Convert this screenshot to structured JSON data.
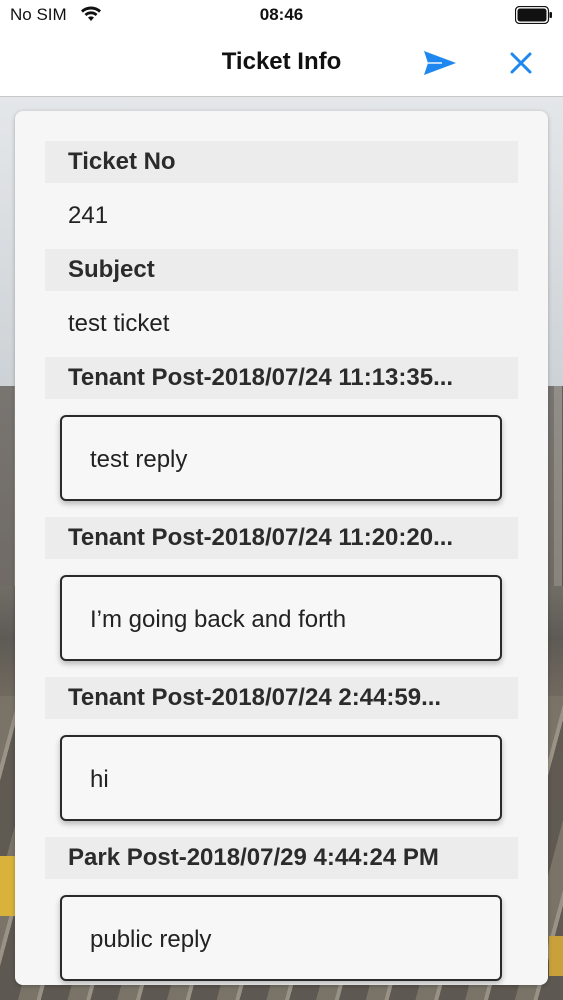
{
  "status_bar": {
    "carrier": "No SIM",
    "time": "08:46"
  },
  "nav": {
    "title": "Ticket Info",
    "send_icon": "send-icon",
    "close_icon": "close-icon",
    "accent_color": "#1e87f0"
  },
  "ticket": {
    "number_label": "Ticket No",
    "number_value": "241",
    "subject_label": "Subject",
    "subject_value": "test ticket"
  },
  "posts": [
    {
      "header": "Tenant Post-2018/07/24 11:13:35...",
      "message": "test reply"
    },
    {
      "header": "Tenant Post-2018/07/24 11:20:20...",
      "message": "I’m going back and forth"
    },
    {
      "header": "Tenant Post-2018/07/24 2:44:59...",
      "message": "hi"
    },
    {
      "header": "Park Post-2018/07/29 4:44:24 PM",
      "message": "public reply"
    }
  ]
}
